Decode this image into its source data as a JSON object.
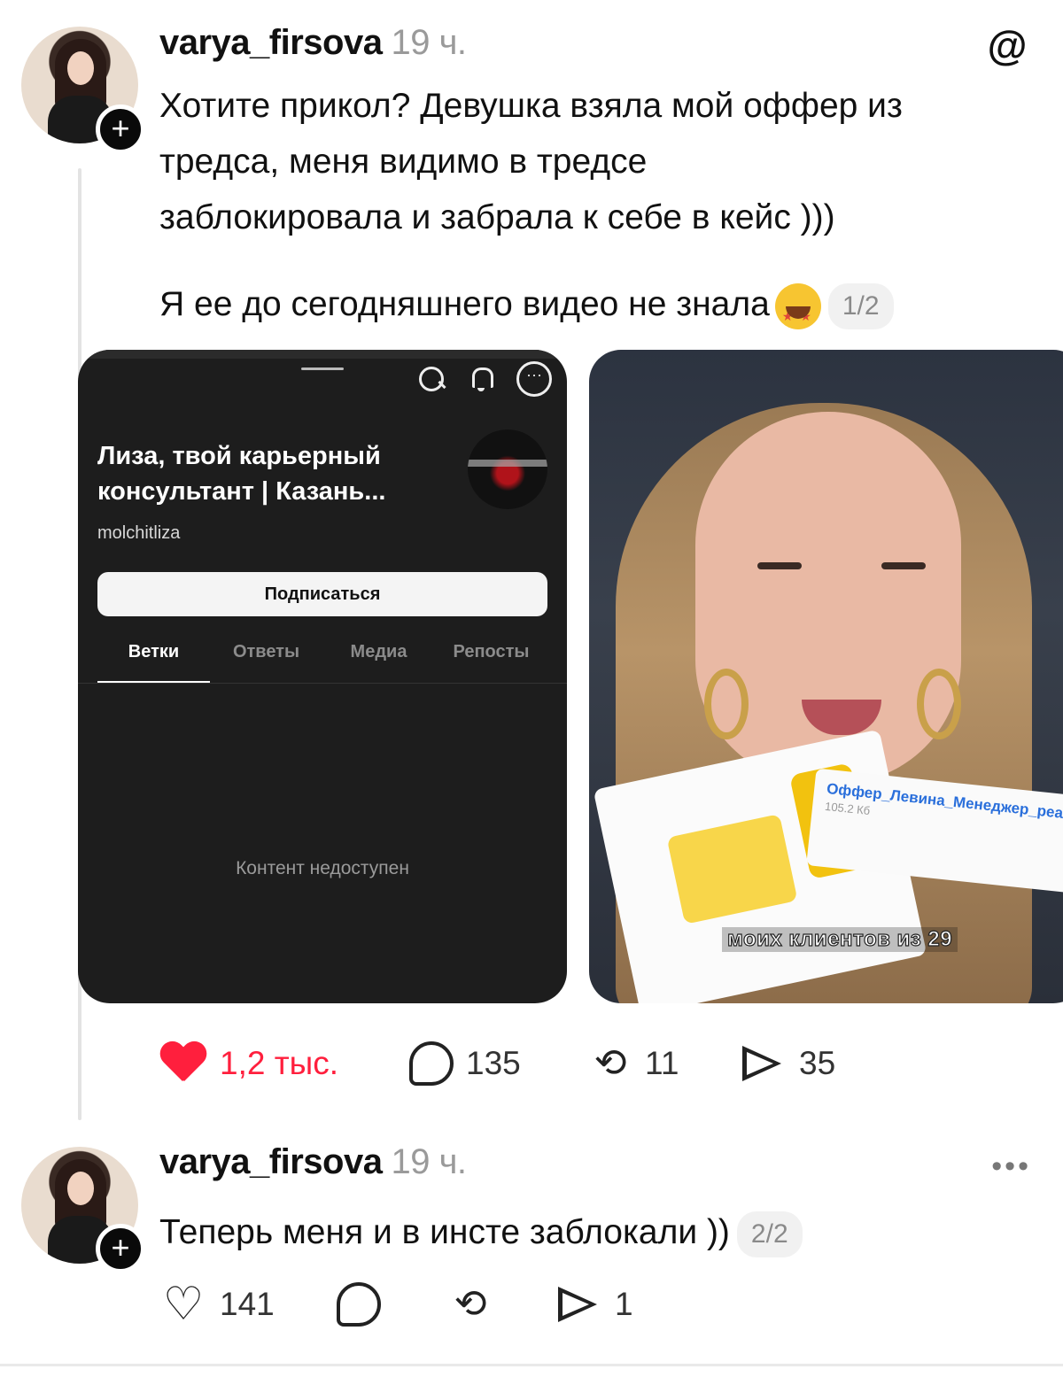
{
  "post1": {
    "username": "varya_firsova",
    "time": "19 ч.",
    "text_line1": "Хотите прикол? Девушка взяла мой оффер из",
    "text_line2": "тредса, меня видимо в тредсе",
    "text_line3": "заблокировала и забрала к себе в кейс )))",
    "text_line4": "Я ее до сегодняшнего видео не знала",
    "pager": "1/2",
    "actions": {
      "likes": "1,2 тыс.",
      "comments": "135",
      "reposts": "11",
      "shares": "35"
    }
  },
  "left_image": {
    "profile_name": "Лиза, твой карьерный консультант | Казань...",
    "profile_handle": "molchitliza",
    "subscribe_label": "Подписаться",
    "tabs": [
      "Ветки",
      "Ответы",
      "Медиа",
      "Репосты"
    ],
    "empty_text": "Контент недоступен"
  },
  "right_image": {
    "file_name": "Оффер_Левина_Менеджер_реализации_md.pdf",
    "file_size": "105.2 Кб",
    "caption": "моих клиентов из 29"
  },
  "post2": {
    "username": "varya_firsova",
    "time": "19 ч.",
    "text": "Теперь меня и в инсте заблокали ))",
    "pager": "2/2",
    "actions": {
      "likes": "141",
      "shares": "1"
    }
  },
  "icons": {
    "logo": "threads-logo-icon",
    "more": "more-icon"
  },
  "colors": {
    "like_red": "#ff1f3d",
    "text": "#111111",
    "muted": "#9a9a9a"
  }
}
